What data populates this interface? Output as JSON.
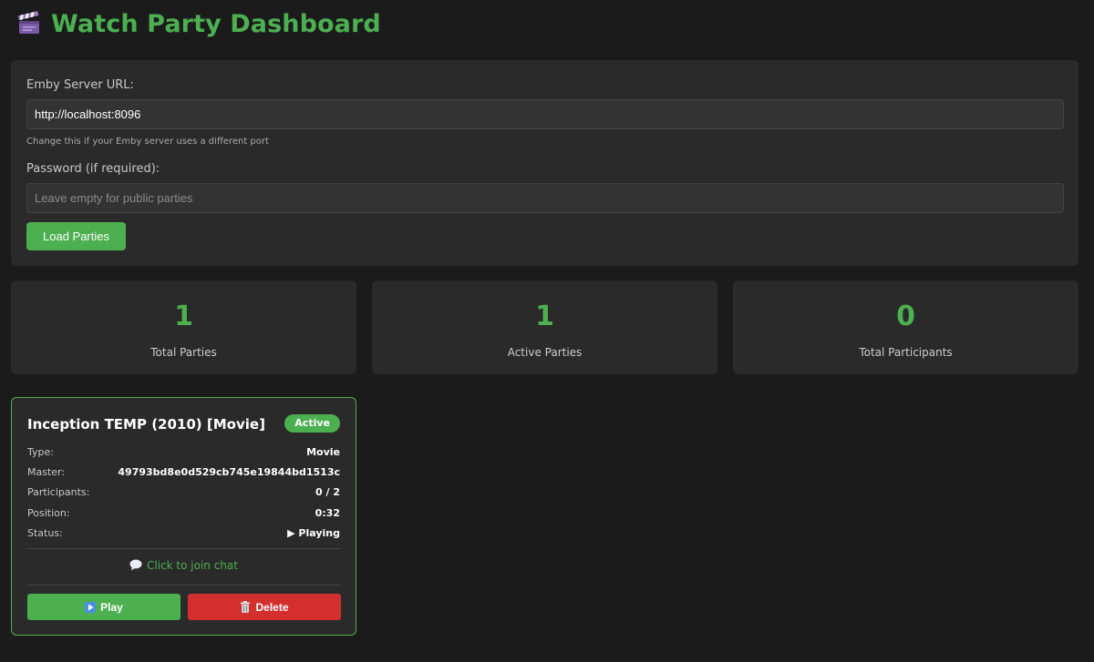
{
  "header": {
    "title": "Watch Party Dashboard",
    "icon": "clapperboard-icon"
  },
  "config": {
    "server_url_label": "Emby Server URL:",
    "server_url_value": "http://localhost:8096",
    "server_url_help": "Change this if your Emby server uses a different port",
    "password_label": "Password (if required):",
    "password_placeholder": "Leave empty for public parties",
    "password_value": "",
    "load_button_label": "Load Parties"
  },
  "stats": [
    {
      "value": "1",
      "label": "Total Parties"
    },
    {
      "value": "1",
      "label": "Active Parties"
    },
    {
      "value": "0",
      "label": "Total Participants"
    }
  ],
  "parties": [
    {
      "title": "Inception TEMP (2010) [Movie]",
      "badge": "Active",
      "rows": [
        {
          "label": "Type:",
          "value": "Movie"
        },
        {
          "label": "Master:",
          "value": "49793bd8e0d529cb745e19844bd1513c"
        },
        {
          "label": "Participants:",
          "value": "0 / 2"
        },
        {
          "label": "Position:",
          "value": "0:32"
        },
        {
          "label": "Status:",
          "value": "▶ Playing"
        }
      ],
      "chat_label": "Click to join chat",
      "play_label": "Play",
      "delete_label": "Delete"
    }
  ],
  "colors": {
    "accent": "#4caf50",
    "danger": "#d32f2f",
    "background": "#1b1b1b",
    "panel": "#2a2a2a"
  }
}
